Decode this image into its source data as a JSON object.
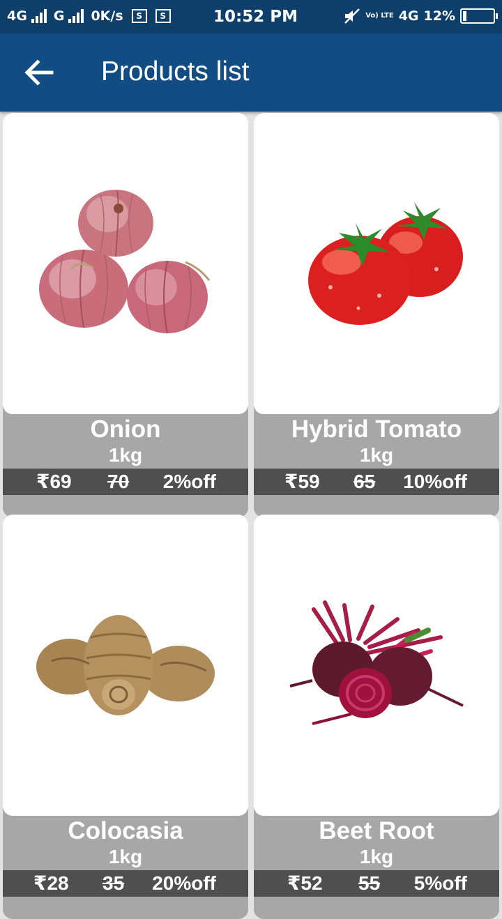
{
  "status_bar": {
    "net1": "4G",
    "net2": "G",
    "speed": "0K/s",
    "sim1_label": "S",
    "sim2_label": "S",
    "time": "10:52 PM",
    "volte": "Vo) LTE",
    "net3": "4G",
    "battery_pct": "12%",
    "battery_level": 0.12
  },
  "app_bar": {
    "back_icon": "arrow-left-icon",
    "title": "Products list"
  },
  "products": [
    {
      "name": "Onion",
      "qty": "1kg",
      "price": "₹69",
      "mrp": "70",
      "discount": "2%off",
      "image": "onion"
    },
    {
      "name": "Hybrid Tomato",
      "qty": "1kg",
      "price": "₹59",
      "mrp": "65",
      "discount": "10%off",
      "image": "tomato"
    },
    {
      "name": "Colocasia",
      "qty": "1kg",
      "price": "₹28",
      "mrp": "35",
      "discount": "20%off",
      "image": "colocasia"
    },
    {
      "name": "Beet Root",
      "qty": "1kg",
      "price": "₹52",
      "mrp": "55",
      "discount": "5%off",
      "image": "beet-root"
    }
  ],
  "colors": {
    "status_bar": "#0e3f6b",
    "app_bar": "#114c82",
    "card_footer": "#a7a7a7",
    "price_strip": "#4f4f4f"
  }
}
